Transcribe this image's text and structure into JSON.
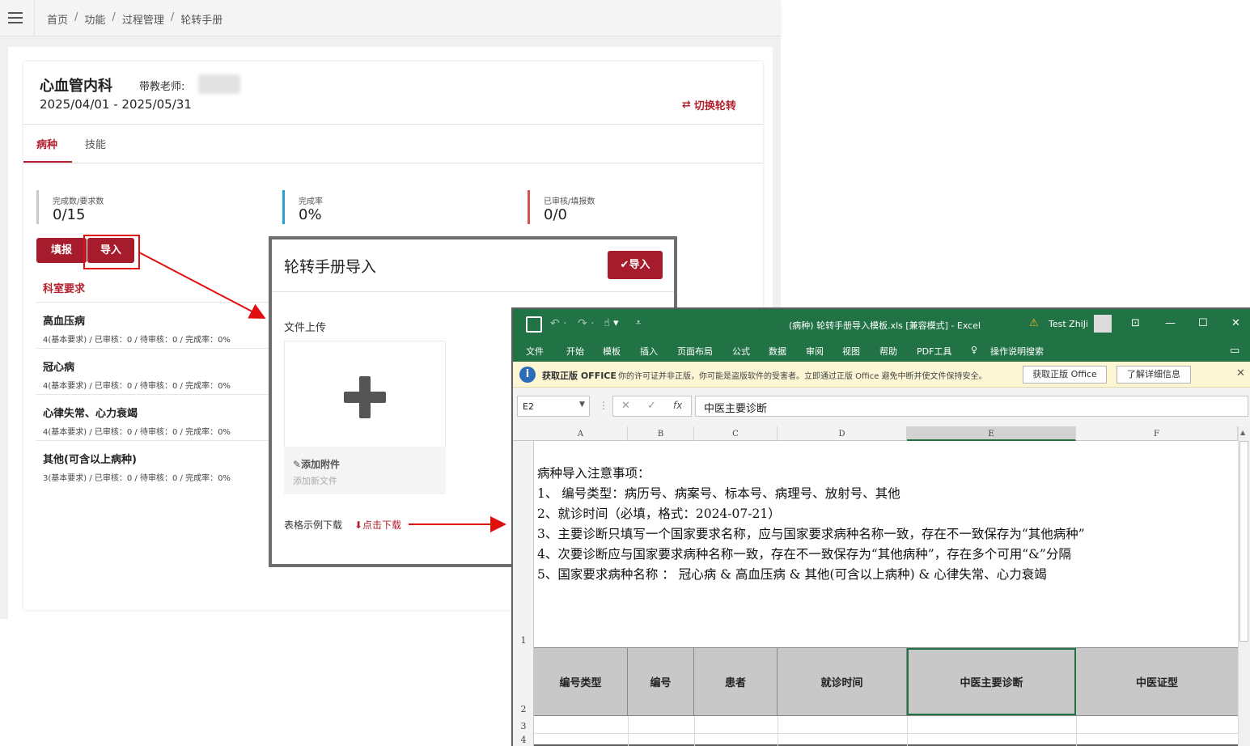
{
  "breadcrumb": [
    "首页",
    "功能",
    "过程管理",
    "轮转手册"
  ],
  "header": {
    "department": "心血管内科",
    "teacher_label": "带教老师:",
    "date_range": "2025/04/01 - 2025/05/31",
    "switch_label": "切换轮转"
  },
  "tabs": [
    "病种",
    "技能"
  ],
  "stats": [
    {
      "label": "完成数/要求数",
      "value": "0/15",
      "color": "#c8c8c8"
    },
    {
      "label": "完成率",
      "value": "0%",
      "color": "#2a9fd6"
    },
    {
      "label": "已审核/填报数",
      "value": "0/0",
      "color": "#d9534f"
    }
  ],
  "actions": {
    "fill": "填报",
    "import": "导入"
  },
  "requirements": {
    "title": "科室要求",
    "items": [
      {
        "name": "高血压病",
        "status": "4(基本要求) / 已审核：0 / 待审核：0 / 完成率：0%"
      },
      {
        "name": "冠心病",
        "status": "4(基本要求) / 已审核：0 / 待审核：0 / 完成率：0%"
      },
      {
        "name": "心律失常、心力衰竭",
        "status": "4(基本要求) / 已审核：0 / 待审核：0 / 完成率：0%"
      },
      {
        "name": "其他(可含以上病种)",
        "status": "3(基本要求) / 已审核：0 / 待审核：0 / 完成率：0%"
      }
    ]
  },
  "modal": {
    "title": "轮转手册导入",
    "import_button": "✔导入",
    "upload_label": "文件上传",
    "attach_label": "✎添加附件",
    "attach_sub": "添加新文件",
    "download_label": "表格示例下载",
    "download_link": "⬇点击下载"
  },
  "excel": {
    "title": "(病种) 轮转手册导入模板.xls  [兼容模式]  -  Excel",
    "user": "Test ZhiJi",
    "menu": [
      "文件",
      "开始",
      "模板",
      "插入",
      "页面布局",
      "公式",
      "数据",
      "审阅",
      "视图",
      "帮助",
      "PDF工具",
      "操作说明搜索"
    ],
    "info_bold": "获取正版 OFFICE",
    "info_text": "你的许可证并非正版，你可能是盗版软件的受害者。立即通过正版 Office 避免中断并使文件保持安全。",
    "info_btn1": "获取正版 Office",
    "info_btn2": "了解详细信息",
    "name_box": "E2",
    "formula": "中医主要诊断",
    "columns": [
      "A",
      "B",
      "C",
      "D",
      "E",
      "F"
    ],
    "rows": [
      "1",
      "2",
      "3",
      "4"
    ],
    "notes": [
      "病种导入注意事项：",
      "1、 编号类型：病历号、病案号、标本号、病理号、放射号、其他",
      "2、就诊时间（必填，格式：2024-07-21）",
      "3、主要诊断只填写一个国家要求名称，应与国家要求病种名称一致，存在不一致保存为“其他病种”",
      "4、次要诊断应与国家要求病种名称一致，存在不一致保存为“其他病种”，存在多个可用“&”分隔",
      "5、国家要求病种名称 ： 冠心病 & 高血压病 & 其他(可含以上病种) & 心律失常、心力衰竭"
    ],
    "header_row": [
      "编号类型",
      "编号",
      "患者",
      "就诊时间",
      "中医主要诊断",
      "中医证型"
    ]
  }
}
